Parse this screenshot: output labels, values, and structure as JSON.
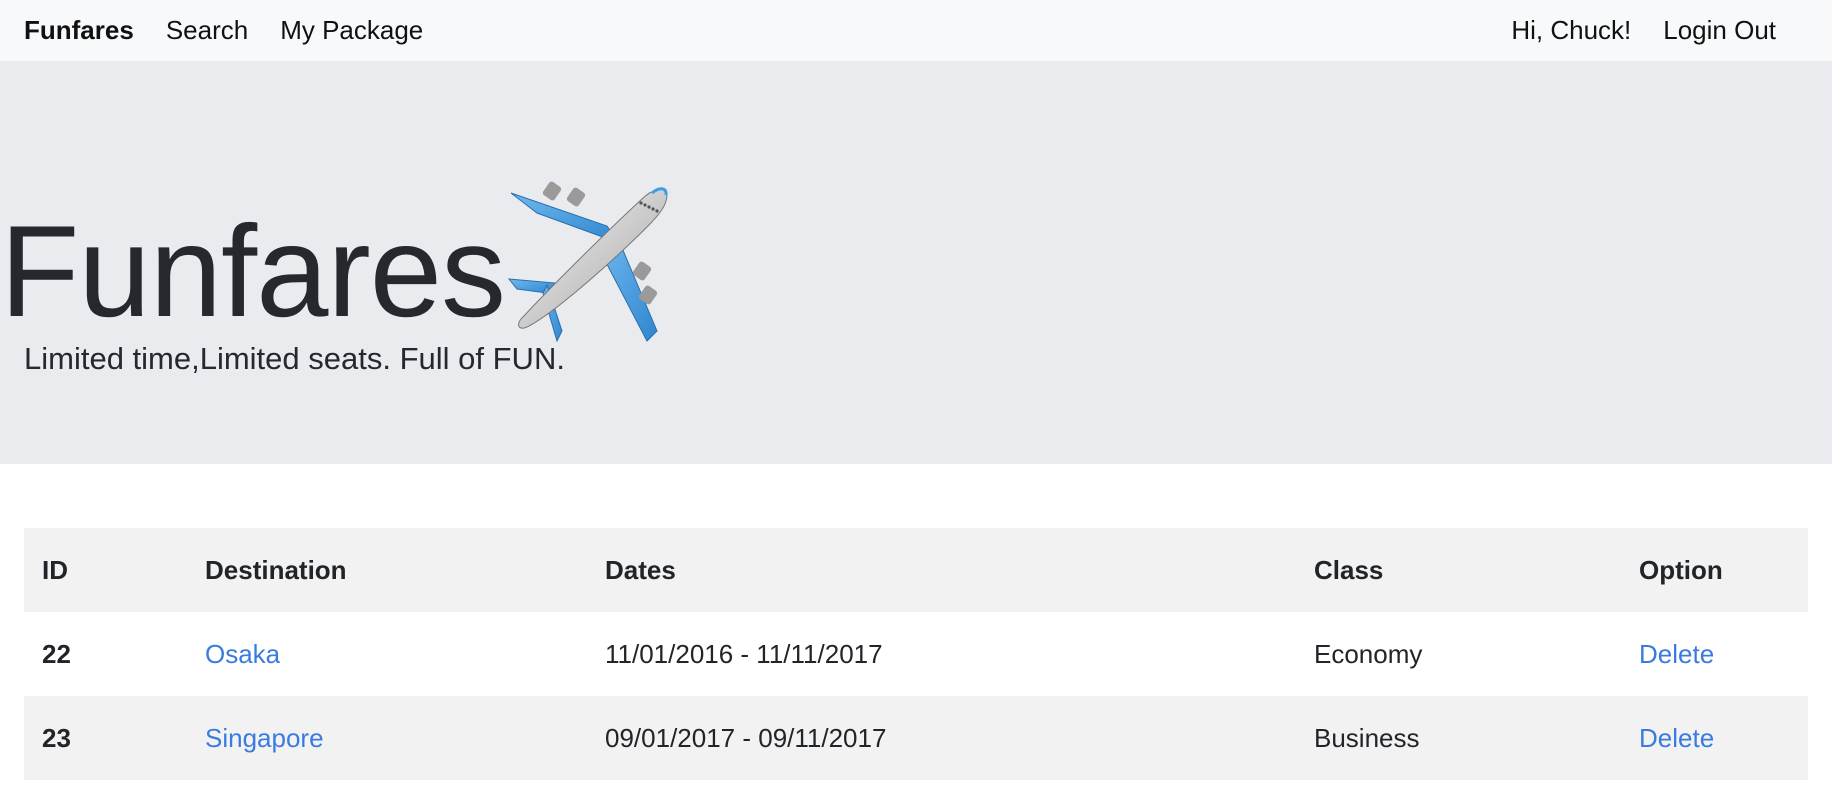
{
  "navbar": {
    "brand": "Funfares",
    "links": [
      "Search",
      "My Package"
    ],
    "greeting": "Hi, Chuck!",
    "logout": "Login Out"
  },
  "hero": {
    "title": "Funfares",
    "icon": "airplane-icon",
    "subtitle": "Limited time,Limited seats. Full of FUN."
  },
  "table": {
    "headers": [
      "ID",
      "Destination",
      "Dates",
      "Class",
      "Option"
    ],
    "rows": [
      {
        "id": "22",
        "destination": "Osaka",
        "dates": "11/01/2016 - 11/11/2017",
        "class": "Economy",
        "option": "Delete"
      },
      {
        "id": "23",
        "destination": "Singapore",
        "dates": "09/01/2017 - 09/11/2017",
        "class": "Business",
        "option": "Delete"
      }
    ]
  },
  "colors": {
    "navbar_bg": "#f8f9fa",
    "jumbotron_bg": "#e9ebef",
    "link": "#3a7be0",
    "stripe": "#f2f2f2"
  }
}
